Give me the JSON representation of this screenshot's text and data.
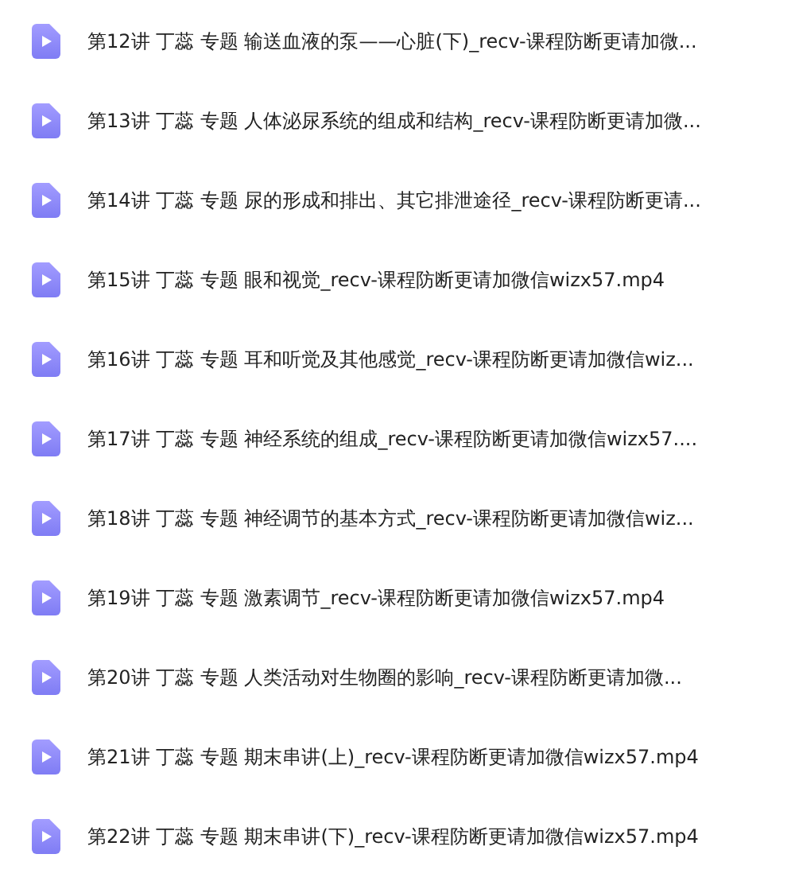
{
  "files": [
    {
      "name": "第12讲 丁蕊 专题 输送血液的泵——心脏(下)_recv-课程防断更请加微..."
    },
    {
      "name": "第13讲 丁蕊 专题 人体泌尿系统的组成和结构_recv-课程防断更请加微..."
    },
    {
      "name": "第14讲 丁蕊 专题 尿的形成和排出、其它排泄途径_recv-课程防断更请..."
    },
    {
      "name": "第15讲 丁蕊 专题 眼和视觉_recv-课程防断更请加微信wizx57.mp4"
    },
    {
      "name": "第16讲 丁蕊 专题 耳和听觉及其他感觉_recv-课程防断更请加微信wiz..."
    },
    {
      "name": "第17讲 丁蕊 专题 神经系统的组成_recv-课程防断更请加微信wizx57...."
    },
    {
      "name": "第18讲 丁蕊 专题 神经调节的基本方式_recv-课程防断更请加微信wiz..."
    },
    {
      "name": "第19讲 丁蕊 专题 激素调节_recv-课程防断更请加微信wizx57.mp4"
    },
    {
      "name": "第20讲 丁蕊 专题 人类活动对生物圈的影响_recv-课程防断更请加微..."
    },
    {
      "name": "第21讲 丁蕊 专题 期末串讲(上)_recv-课程防断更请加微信wizx57.mp4"
    },
    {
      "name": "第22讲 丁蕊 专题 期末串讲(下)_recv-课程防断更请加微信wizx57.mp4"
    }
  ]
}
